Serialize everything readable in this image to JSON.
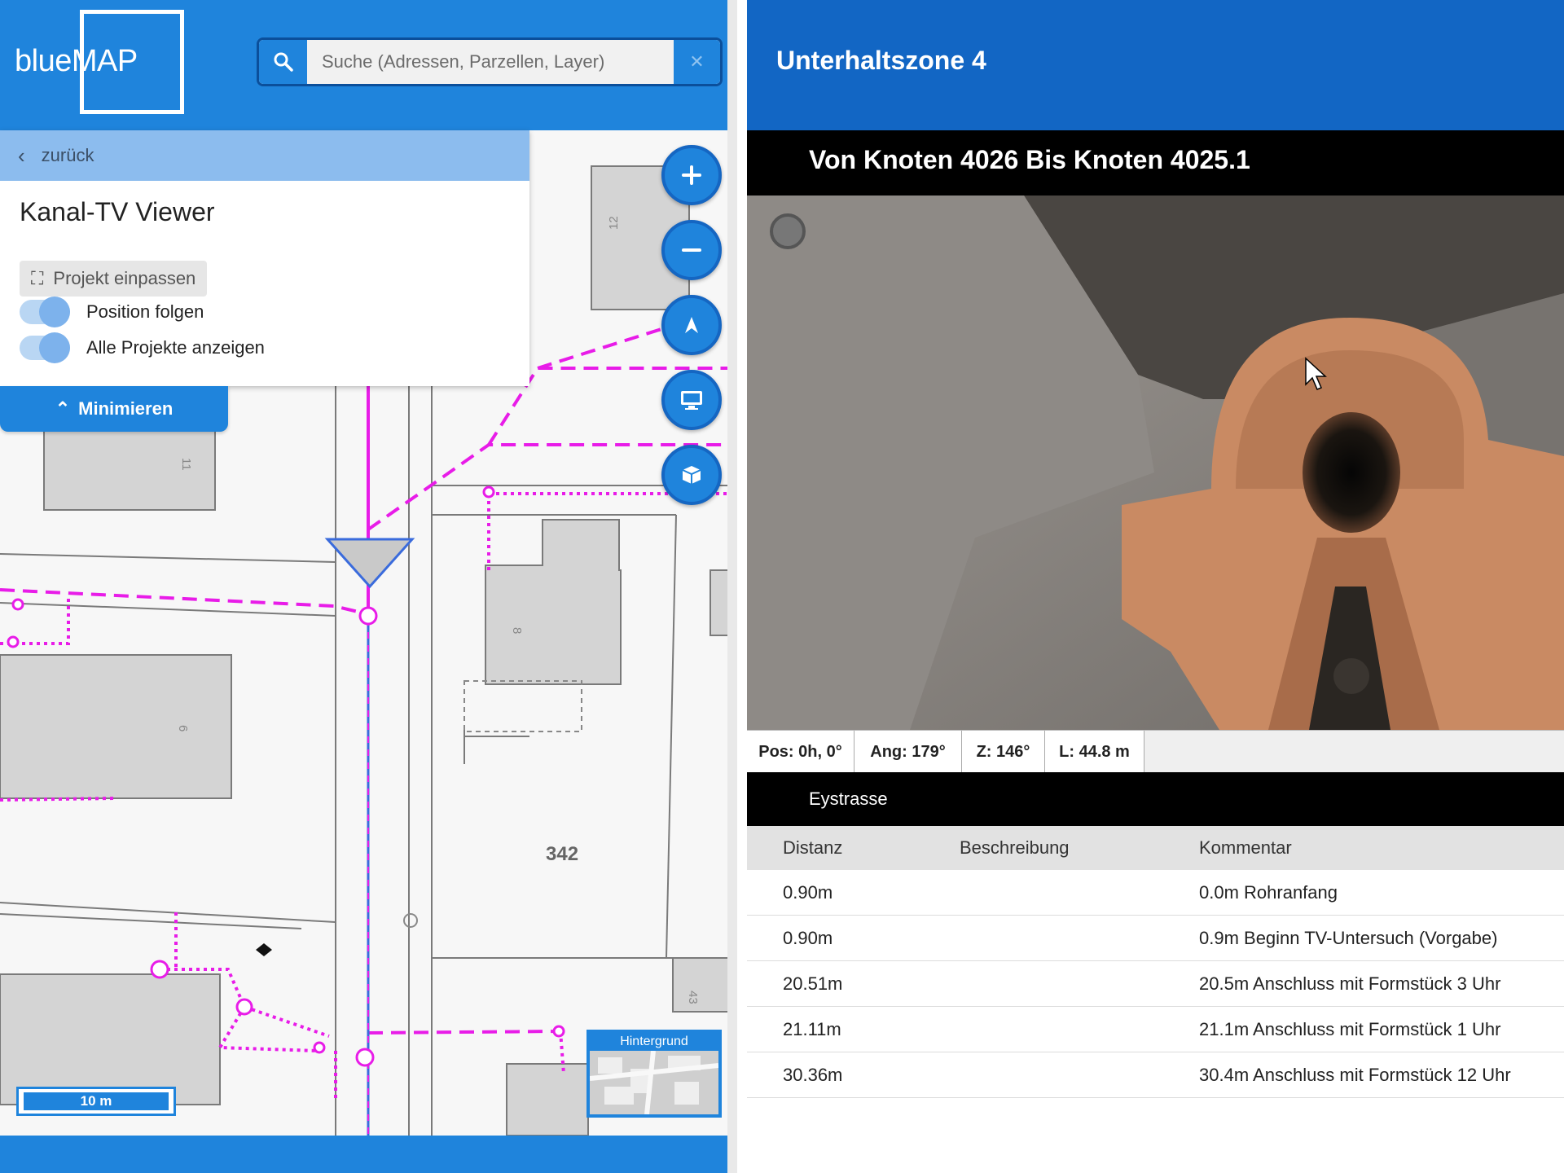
{
  "app": {
    "logo": "blueMAP"
  },
  "search": {
    "placeholder": "Suche (Adressen, Parzellen, Layer)"
  },
  "panel": {
    "back_label": "zurück",
    "title": "Kanal-TV Viewer",
    "fit_button": "Projekt einpassen",
    "toggles": [
      {
        "label": "Position folgen",
        "on": true
      },
      {
        "label": "Alle Projekte anzeigen",
        "on": true
      }
    ],
    "minimize_label": "Minimieren"
  },
  "map": {
    "parcel_number": "342",
    "house_numbers": [
      "12",
      "11",
      "8",
      "6",
      "43"
    ],
    "scale_label": "10 m",
    "background_label": "Hintergrund",
    "colors": {
      "sewer_line": "#e81ce8",
      "pipe_axis": "#3a6bdc",
      "building": "#d4d4d4",
      "brand": "#1f84dc"
    }
  },
  "viewer": {
    "zone_title": "Unterhaltszone 4",
    "segment_title": "Von Knoten 4026 Bis Knoten 4025.1",
    "metrics": {
      "pos": "Pos: 0h, 0°",
      "ang": "Ang: 179°",
      "z": "Z: 146°",
      "l": "L: 44.8 m"
    },
    "street": "Eystrasse",
    "table": {
      "headers": [
        "Distanz",
        "Beschreibung",
        "Kommentar"
      ],
      "rows": [
        {
          "distanz": "0.90m",
          "beschreibung": "",
          "kommentar": "0.0m Rohranfang"
        },
        {
          "distanz": "0.90m",
          "beschreibung": "",
          "kommentar": "0.9m Beginn TV-Untersuch (Vorgabe)"
        },
        {
          "distanz": "20.51m",
          "beschreibung": "",
          "kommentar": "20.5m Anschluss mit Formstück 3 Uhr"
        },
        {
          "distanz": "21.11m",
          "beschreibung": "",
          "kommentar": "21.1m Anschluss mit Formstück 1 Uhr"
        },
        {
          "distanz": "30.36m",
          "beschreibung": "",
          "kommentar": "30.4m Anschluss mit Formstück 12 Uhr"
        }
      ]
    }
  }
}
